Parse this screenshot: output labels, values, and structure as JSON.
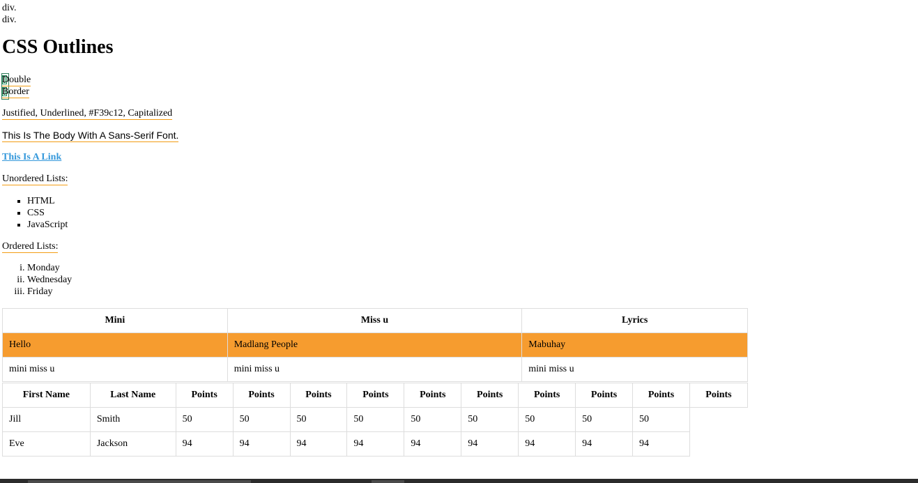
{
  "top_divs": [
    "div.",
    "div."
  ],
  "heading": "CSS Outlines",
  "double_border": {
    "line1": "Double",
    "line2": "Border"
  },
  "justified_text": "Justified, Underlined, #F39c12, Capitalized",
  "sans_text": "This Is The Body With A Sans-Serif Font.",
  "link_text": "This Is A Link",
  "unordered_label": "Unordered Lists:",
  "unordered_items": [
    "HTML",
    "CSS",
    "JavaScript"
  ],
  "ordered_label": "Ordered Lists:",
  "ordered_items": [
    "Monday",
    "Wednesday",
    "Friday"
  ],
  "table1": {
    "headers": [
      "Mini",
      "Miss u",
      "Lyrics"
    ],
    "rows": [
      [
        "Hello",
        "Madlang People",
        "Mabuhay"
      ],
      [
        "mini miss u",
        "mini miss u",
        "mini miss u"
      ]
    ],
    "highlight_color": "#f69c2f"
  },
  "table2": {
    "headers": [
      "First Name",
      "Last Name",
      "Points",
      "Points",
      "Points",
      "Points",
      "Points",
      "Points",
      "Points",
      "Points",
      "Points",
      "Points"
    ],
    "rows": [
      [
        "Jill",
        "Smith",
        "50",
        "50",
        "50",
        "50",
        "50",
        "50",
        "50",
        "50",
        "50"
      ],
      [
        "Eve",
        "Jackson",
        "94",
        "94",
        "94",
        "94",
        "94",
        "94",
        "94",
        "94",
        "94"
      ]
    ]
  },
  "colors": {
    "underline": "#f39c12",
    "link": "#3498db",
    "double_border": "#1e8c5a"
  }
}
